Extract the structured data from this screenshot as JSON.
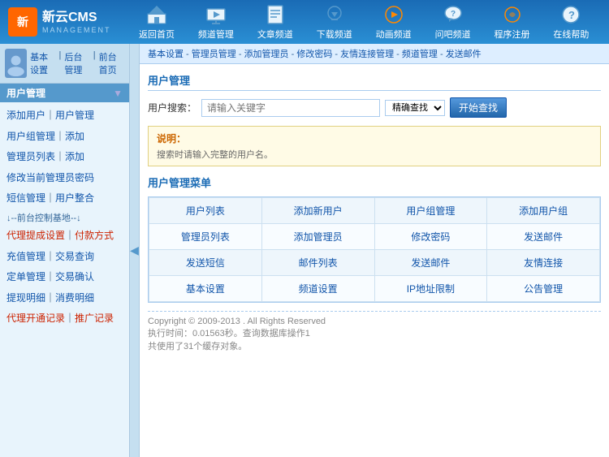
{
  "logo": {
    "icon": "新",
    "name": "新云CMS",
    "sub": "MANAGEMENT"
  },
  "nav": {
    "items": [
      {
        "id": "home",
        "label": "返回首页",
        "icon": "🏠"
      },
      {
        "id": "channel",
        "label": "频道管理",
        "icon": "📺"
      },
      {
        "id": "article",
        "label": "文章频道",
        "icon": "📄"
      },
      {
        "id": "download",
        "label": "下载频道",
        "icon": "⬇"
      },
      {
        "id": "animation",
        "label": "动画频道",
        "icon": "🎬"
      },
      {
        "id": "ask",
        "label": "问吧频道",
        "icon": "💬"
      },
      {
        "id": "register",
        "label": "程序注册",
        "icon": "🔧"
      },
      {
        "id": "help",
        "label": "在线帮助",
        "icon": "❓"
      }
    ]
  },
  "sidebar": {
    "avatar_text": "👤",
    "top_links": [
      "基本设置",
      "后台管理",
      "前台首页"
    ],
    "section_title": "用户管理",
    "menu_items": [
      {
        "text": "添加用户",
        "sep": true,
        "right": "用户管理"
      },
      {
        "text": "用户组管理",
        "sep": true,
        "right": "添加"
      },
      {
        "text": "管理员列表",
        "sep": true,
        "right": "添加"
      },
      {
        "text": "修改当前管理员密码",
        "sep": false,
        "right": ""
      },
      {
        "text": "短信管理",
        "sep": true,
        "right": "用户整合"
      },
      {
        "divider": "↓--前台控制基地--↓"
      },
      {
        "text": "代理提成设置",
        "sep": true,
        "right": "付款方式",
        "red": true
      },
      {
        "text": "充值管理",
        "sep": true,
        "right": "交易查询"
      },
      {
        "text": "定单管理",
        "sep": true,
        "right": "交易确认"
      },
      {
        "text": "提现明细",
        "sep": true,
        "right": "消费明细"
      },
      {
        "text": "代理开通记录",
        "sep": true,
        "right": "推广记录",
        "red": true
      }
    ]
  },
  "breadcrumb": {
    "items": [
      "基本设置",
      "管理员管理",
      "添加管理员",
      "修改密码",
      "友情连接管理",
      "频道管理",
      "发送邮件"
    ]
  },
  "page_title": "用户管理",
  "search": {
    "label": "用户搜索：",
    "placeholder": "请输入关键字",
    "option": "精确查找",
    "button": "开始查找"
  },
  "note": {
    "title": "说明：",
    "text": "搜索时请输入完整的用户名。"
  },
  "menu_grid_title": "用户管理菜单",
  "menu_grid": {
    "rows": [
      [
        "用户列表",
        "添加新用户",
        "用户组管理",
        "添加用户组"
      ],
      [
        "管理员列表",
        "添加管理员",
        "修改密码",
        "发送邮件"
      ],
      [
        "发送短信",
        "邮件列表",
        "发送邮件",
        "友情连接"
      ],
      [
        "基本设置",
        "频道设置",
        "IP地址限制",
        "公告管理"
      ]
    ]
  },
  "footer": {
    "copyright": "Copyright © 2009-2013 . All Rights Reserved",
    "exec_time": "执行时间：0.01563秒。查询数据库操作1",
    "objects": "共使用了31个缓存对象。"
  }
}
